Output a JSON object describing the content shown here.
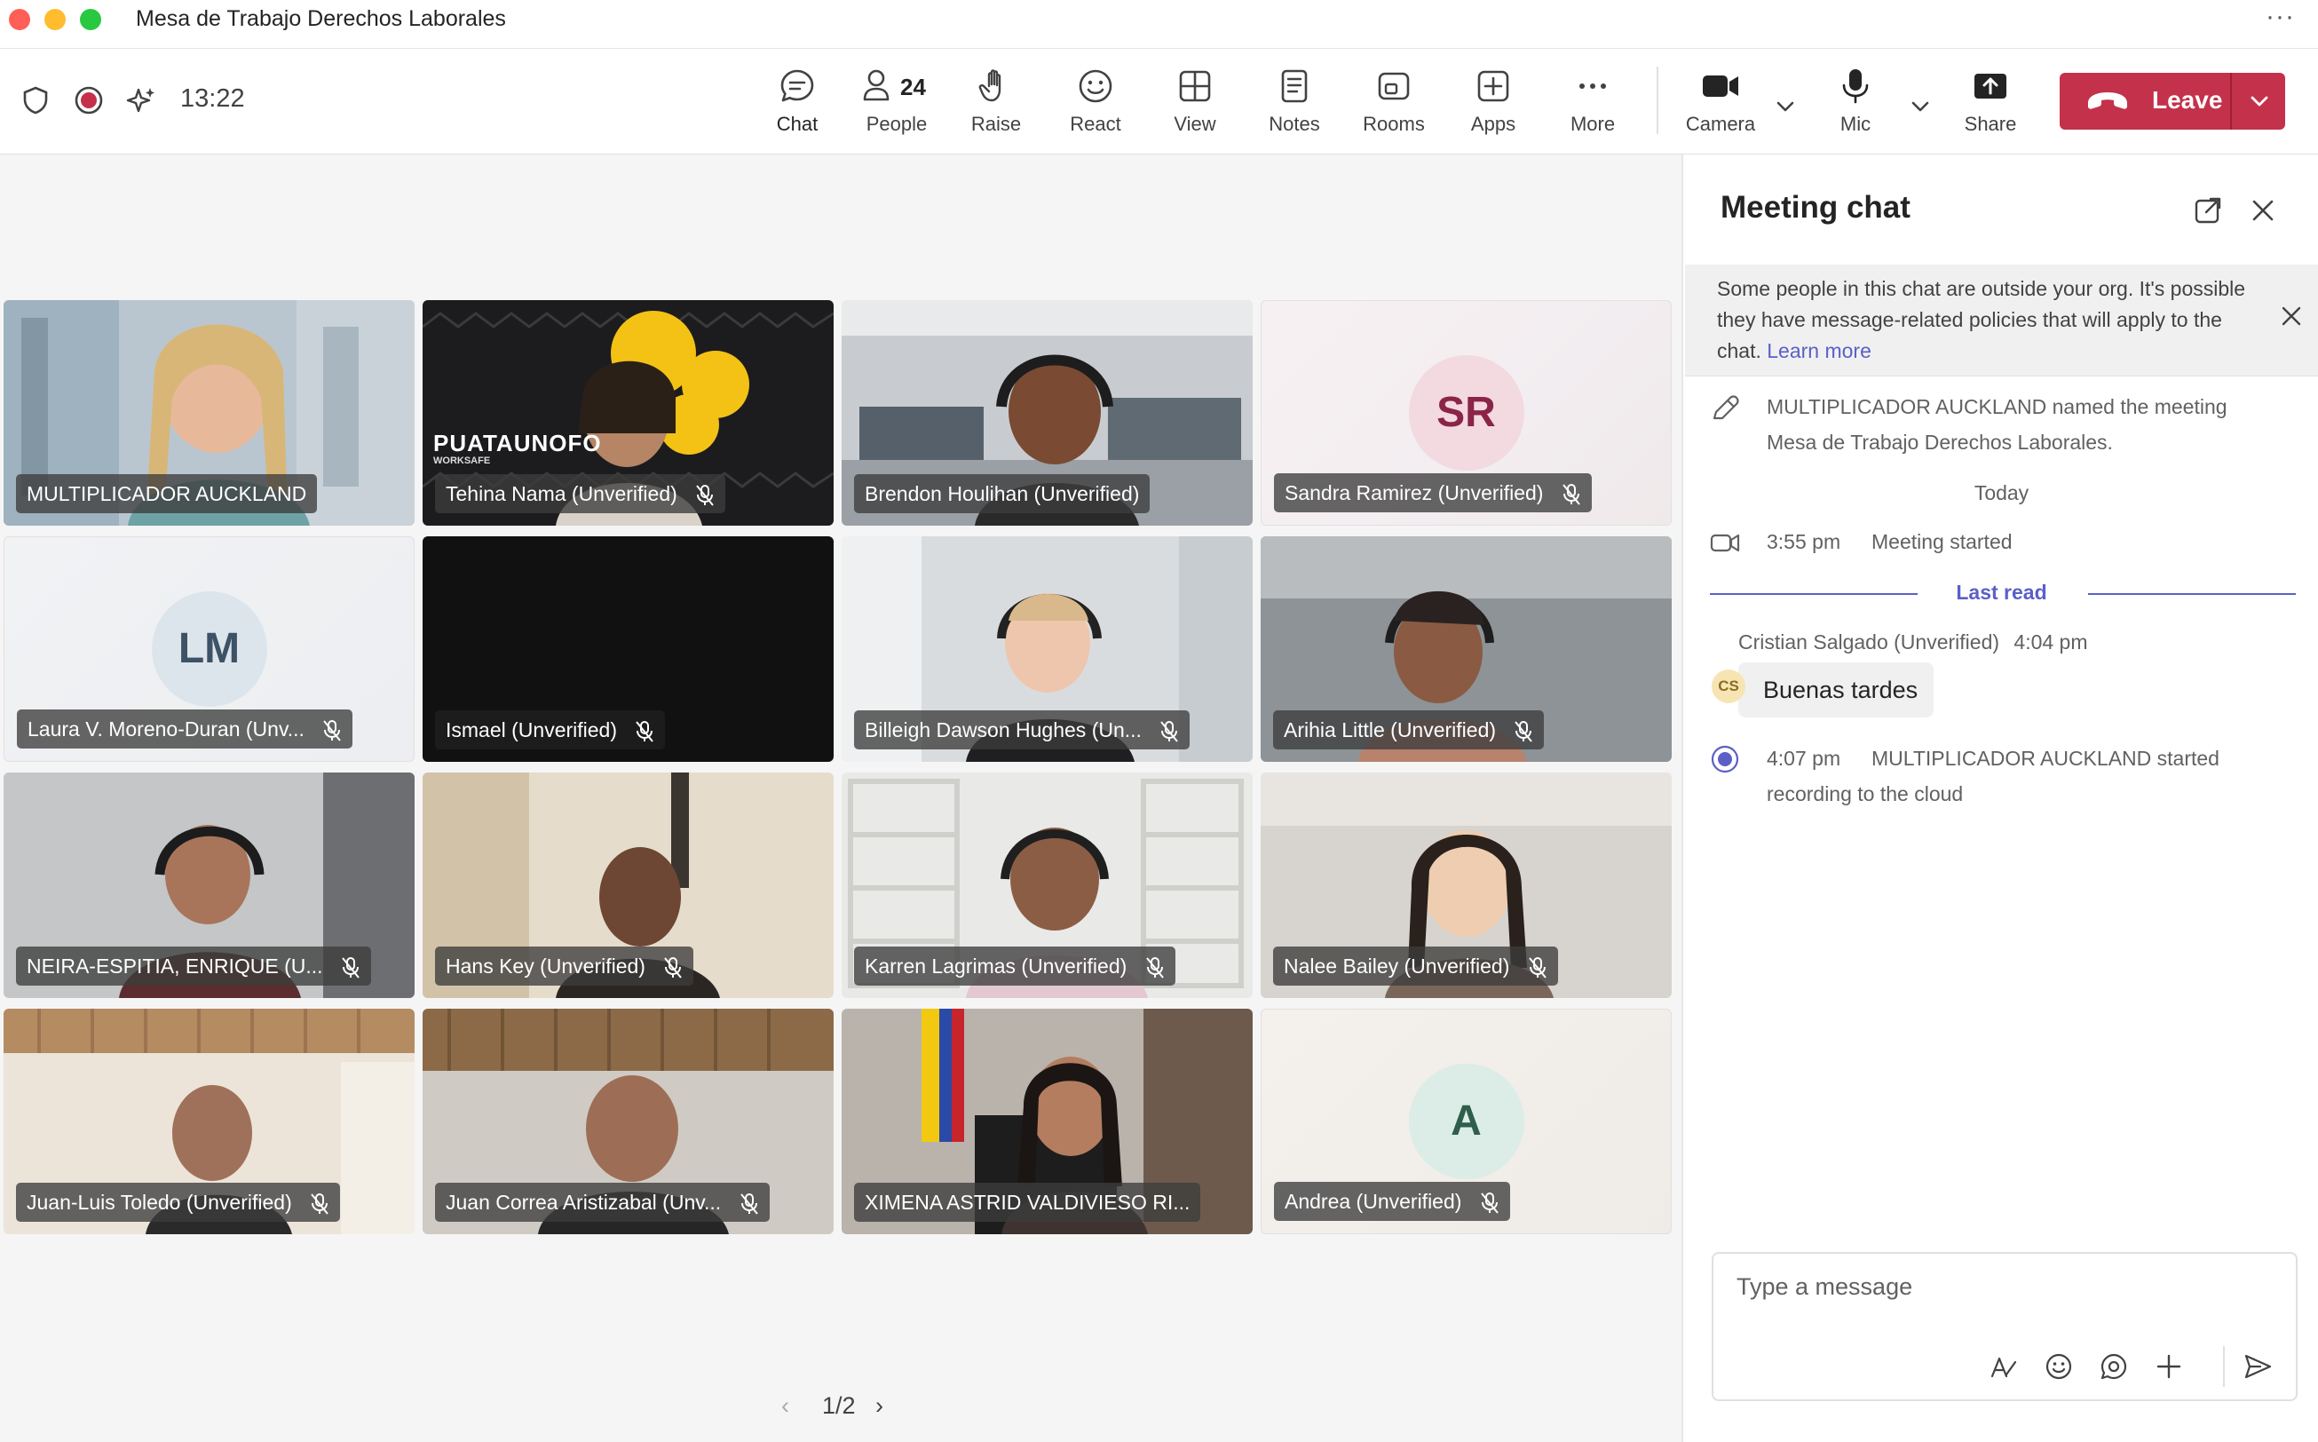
{
  "window": {
    "title": "Mesa de Trabajo Derechos Laborales",
    "more_icon": "more-horizontal-icon"
  },
  "toolbar": {
    "timer": "13:22",
    "people_count": "24",
    "buttons": {
      "chat": "Chat",
      "people": "People",
      "raise": "Raise",
      "react": "React",
      "view": "View",
      "notes": "Notes",
      "rooms": "Rooms",
      "apps": "Apps",
      "more": "More",
      "camera": "Camera",
      "mic": "Mic",
      "share": "Share"
    },
    "leave": "Leave",
    "leave_color": "#c4314b",
    "accent_color": "#5b5fc7"
  },
  "grid": {
    "tiles": [
      {
        "name": "MULTIPLICADOR AUCKLAND",
        "muted": false,
        "type": "video"
      },
      {
        "name": "Tehina Nama (Unverified)",
        "muted": true,
        "type": "video",
        "banner": "PUATAUNOFO",
        "banner_sub": "WORKSAFE"
      },
      {
        "name": "Brendon Houlihan (Unverified)",
        "muted": false,
        "type": "video"
      },
      {
        "name": "Sandra Ramirez (Unverified)",
        "muted": true,
        "type": "avatar",
        "initials": "SR"
      },
      {
        "name": "Laura V. Moreno-Duran (Unv...",
        "muted": true,
        "type": "avatar",
        "initials": "LM"
      },
      {
        "name": "Ismael (Unverified)",
        "muted": true,
        "type": "dark"
      },
      {
        "name": "Billeigh Dawson Hughes (Un...",
        "muted": true,
        "type": "video"
      },
      {
        "name": "Arihia Little (Unverified)",
        "muted": true,
        "type": "video"
      },
      {
        "name": "NEIRA-ESPITIA, ENRIQUE (U...",
        "muted": true,
        "type": "video"
      },
      {
        "name": "Hans Key (Unverified)",
        "muted": true,
        "type": "video"
      },
      {
        "name": "Karren Lagrimas (Unverified)",
        "muted": true,
        "type": "video"
      },
      {
        "name": "Nalee Bailey (Unverified)",
        "muted": true,
        "type": "video"
      },
      {
        "name": "Juan-Luis Toledo (Unverified)",
        "muted": true,
        "type": "video"
      },
      {
        "name": "Juan Correa Aristizabal (Unv...",
        "muted": true,
        "type": "video"
      },
      {
        "name": "XIMENA ASTRID VALDIVIESO RI...",
        "muted": false,
        "type": "video"
      },
      {
        "name": "Andrea (Unverified)",
        "muted": true,
        "type": "avatar",
        "initials": "A"
      }
    ],
    "pager": {
      "current": "1/2",
      "prev": "‹",
      "next": "›"
    }
  },
  "chat": {
    "title": "Meeting chat",
    "notice": "Some people in this chat are outside your org. It's possible they have message-related policies that will apply to the chat.",
    "notice_link": "Learn more",
    "events": {
      "renamed_line1": "MULTIPLICADOR AUCKLAND named the meeting",
      "renamed_line2": "Mesa de Trabajo Derechos Laborales.",
      "today": "Today",
      "started_time": "3:55 pm",
      "started_text": "Meeting started",
      "last_read": "Last read",
      "recording_time": "4:07 pm",
      "recording_line1": "MULTIPLICADOR AUCKLAND started",
      "recording_line2": "recording to the cloud"
    },
    "message": {
      "sender": "Cristian Salgado (Unverified)",
      "time": "4:04 pm",
      "initials": "CS",
      "text": "Buenas tardes"
    },
    "compose": {
      "placeholder": "Type a message"
    }
  }
}
